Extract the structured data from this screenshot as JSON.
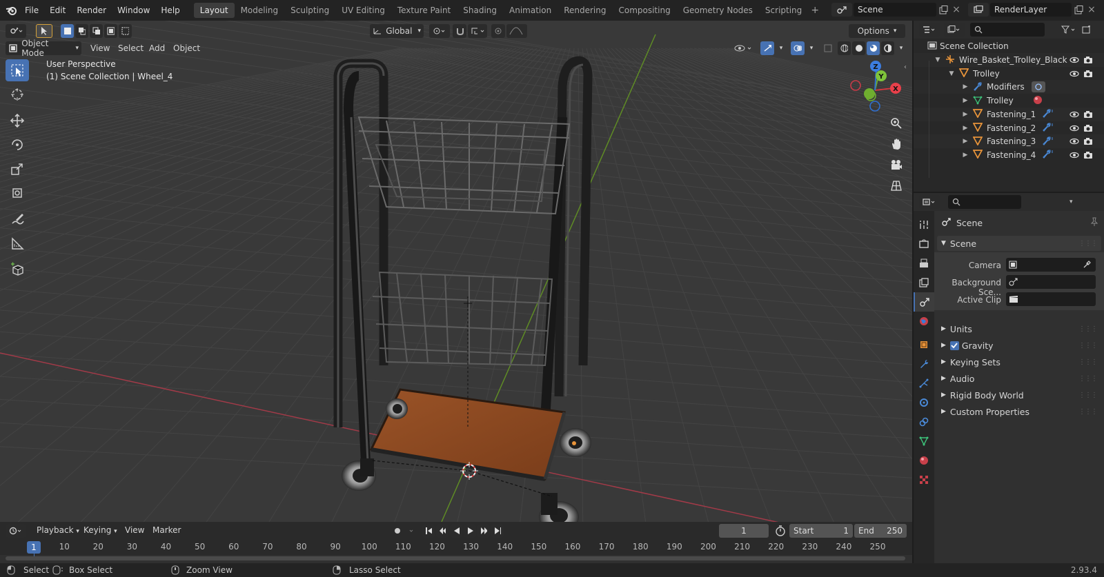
{
  "app": {
    "version": "2.93.4"
  },
  "menubar": {
    "items": [
      "File",
      "Edit",
      "Render",
      "Window",
      "Help"
    ]
  },
  "workspaces": [
    "Layout",
    "Modeling",
    "Sculpting",
    "UV Editing",
    "Texture Paint",
    "Shading",
    "Animation",
    "Rendering",
    "Compositing",
    "Geometry Nodes",
    "Scripting"
  ],
  "active_workspace": "Layout",
  "scene_selector": {
    "value": "Scene"
  },
  "view_layer_selector": {
    "value": "RenderLayer"
  },
  "viewport": {
    "mode": "Object Mode",
    "menus": [
      "View",
      "Select",
      "Add",
      "Object"
    ],
    "orientation": "Global",
    "options_label": "Options",
    "overlay_title": "User Perspective",
    "overlay_subtitle": "(1) Scene Collection | Wheel_4",
    "gizmo_axes": {
      "x": "X",
      "y": "Y",
      "z": "Z"
    }
  },
  "outliner": {
    "root": "Scene Collection",
    "rows": [
      {
        "label": "Wire_Basket_Trolley_Black",
        "indent": 1,
        "icon": "empty-icon"
      },
      {
        "label": "Trolley",
        "indent": 2,
        "icon": "mesh-object-icon"
      },
      {
        "label": "Modifiers",
        "indent": 3,
        "icon": "wrench-icon"
      },
      {
        "label": "Trolley",
        "indent": 3,
        "icon": "mesh-data-icon"
      },
      {
        "label": "Fastening_1",
        "indent": 3,
        "icon": "mesh-object-icon"
      },
      {
        "label": "Fastening_2",
        "indent": 3,
        "icon": "mesh-object-icon"
      },
      {
        "label": "Fastening_3",
        "indent": 3,
        "icon": "mesh-object-icon"
      },
      {
        "label": "Fastening_4",
        "indent": 3,
        "icon": "mesh-object-icon"
      }
    ]
  },
  "properties": {
    "context": "Scene",
    "panel_title": "Scene",
    "fields": [
      {
        "label": "Camera",
        "value": ""
      },
      {
        "label": "Background Sce...",
        "value": ""
      },
      {
        "label": "Active Clip",
        "value": ""
      }
    ],
    "sections": [
      "Units",
      "Gravity",
      "Keying Sets",
      "Audio",
      "Rigid Body World",
      "Custom Properties"
    ],
    "gravity_checked": true
  },
  "timeline": {
    "menus": [
      "Playback",
      "Keying",
      "View",
      "Marker"
    ],
    "current_frame": "1",
    "start_label": "Start",
    "start": "1",
    "end_label": "End",
    "end": "250",
    "ticks": [
      "1",
      "10",
      "20",
      "30",
      "40",
      "50",
      "60",
      "70",
      "80",
      "90",
      "100",
      "110",
      "120",
      "130",
      "140",
      "150",
      "160",
      "170",
      "180",
      "190",
      "200",
      "210",
      "220",
      "230",
      "240",
      "250"
    ]
  },
  "statusbar": {
    "items": [
      "Select",
      "Box Select",
      "Zoom View",
      "Lasso Select"
    ]
  },
  "colors": {
    "accent": "#4772b3",
    "viewport_bg": "#393939",
    "x_axis": "#b3404f",
    "y_axis": "#6a9a2a",
    "trolley_base": "#8c4a22",
    "object_orange": "#e8943a"
  }
}
